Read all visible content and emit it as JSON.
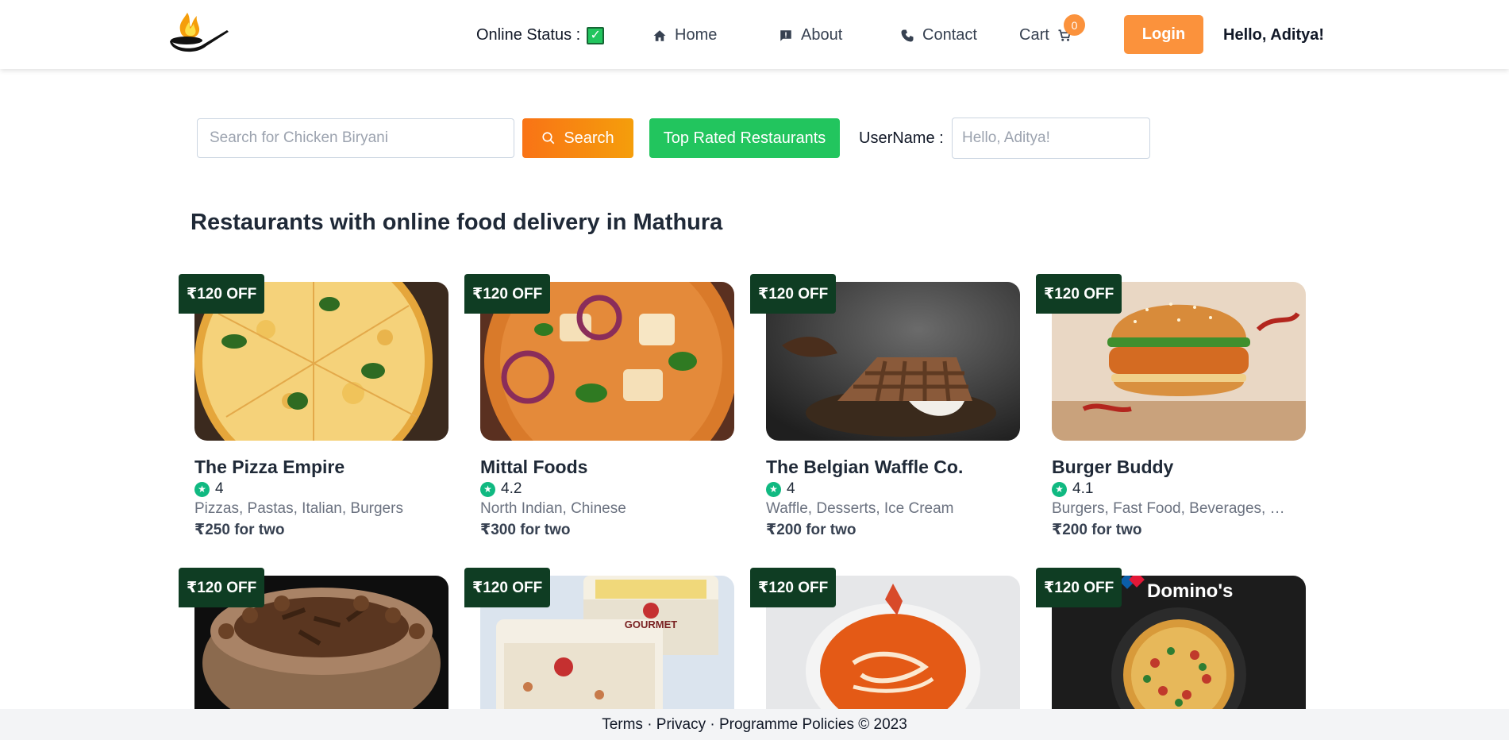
{
  "header": {
    "online_status_label": "Online Status :",
    "nav_home": "Home",
    "nav_about": "About",
    "nav_contact": "Contact",
    "nav_cart": "Cart",
    "cart_count": "0",
    "login_label": "Login",
    "greeting": "Hello, Aditya!"
  },
  "search": {
    "placeholder": "Search for Chicken Biryani",
    "button_label": "Search",
    "top_rated_label": "Top Rated Restaurants",
    "username_label": "UserName :",
    "username_placeholder": "Hello, Aditya!"
  },
  "heading": "Restaurants with online food delivery in Mathura",
  "restaurants": [
    {
      "offer": "₹120 OFF",
      "name": "The Pizza Empire",
      "rating": "4",
      "cuisines": "Pizzas, Pastas, Italian, Burgers",
      "cost": "₹250 for two"
    },
    {
      "offer": "₹120 OFF",
      "name": "Mittal Foods",
      "rating": "4.2",
      "cuisines": "North Indian, Chinese",
      "cost": "₹300 for two"
    },
    {
      "offer": "₹120 OFF",
      "name": "The Belgian Waffle Co.",
      "rating": "4",
      "cuisines": "Waffle, Desserts, Ice Cream",
      "cost": "₹200 for two"
    },
    {
      "offer": "₹120 OFF",
      "name": "Burger Buddy",
      "rating": "4.1",
      "cuisines": "Burgers, Fast Food, Beverages, Piz...",
      "cost": "₹200 for two"
    },
    {
      "offer": "₹120 OFF"
    },
    {
      "offer": "₹120 OFF",
      "image_text": "GOURMET"
    },
    {
      "offer": "₹120 OFF"
    },
    {
      "offer": "₹120 OFF",
      "image_text": "Domino's"
    }
  ],
  "footer": "Terms · Privacy · Programme Policies © 2023",
  "colors": {
    "accent_orange": "#fb923c",
    "green_button": "#22c55e",
    "offer_badge": "#0f3d23",
    "rating_green": "#10b981"
  }
}
